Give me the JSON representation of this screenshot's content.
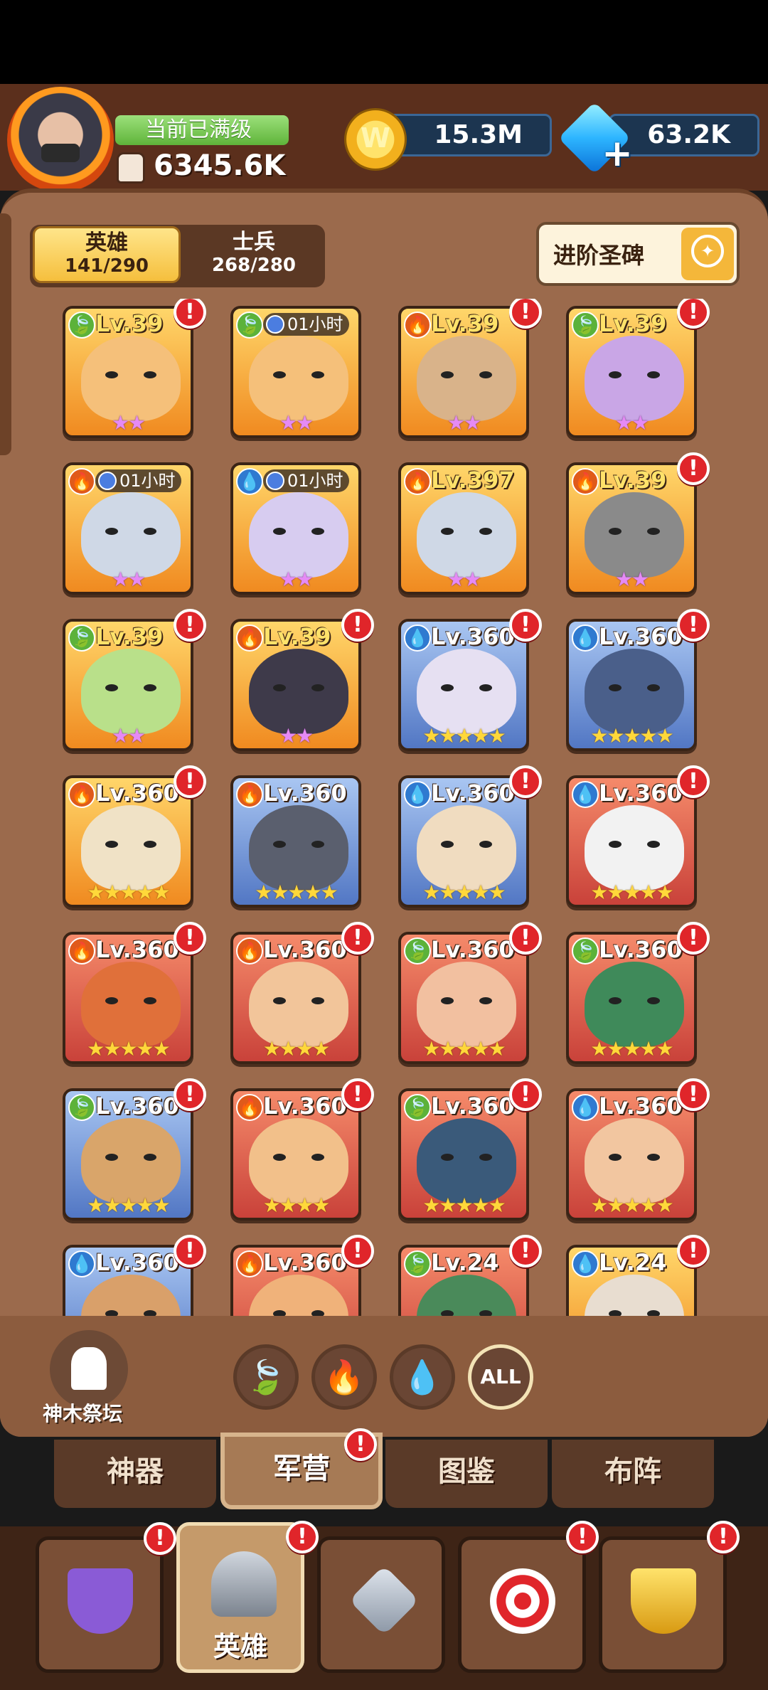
{
  "header": {
    "max_level_label": "当前已满级",
    "power": "6345.6K",
    "gold": "15.3M",
    "gems": "63.2K",
    "coin_symbol": "W",
    "gem_plus": "+"
  },
  "tabs": {
    "hero_label": "英雄",
    "hero_count": "141/290",
    "soldier_label": "士兵",
    "soldier_count": "268/280",
    "advance_label": "进阶圣碑"
  },
  "heroes": [
    {
      "element": "leaf",
      "level": "Lv.39",
      "stars": "★★",
      "star_color": "pink",
      "badge": true,
      "frame": "gold",
      "face": "#f5c07a"
    },
    {
      "element": "leaf",
      "timer": "01小时",
      "stars": "★★",
      "star_color": "pink",
      "badge": false,
      "frame": "gold",
      "face": "#f5c07a"
    },
    {
      "element": "fire",
      "level": "Lv.39",
      "stars": "★★",
      "star_color": "pink",
      "badge": true,
      "frame": "gold",
      "face": "#d9b38a"
    },
    {
      "element": "leaf",
      "level": "Lv.39",
      "stars": "★★",
      "star_color": "pink",
      "badge": true,
      "frame": "gold",
      "face": "#c9a6e6"
    },
    {
      "element": "fire",
      "timer": "01小时",
      "stars": "★★",
      "star_color": "pink",
      "badge": false,
      "frame": "gold",
      "face": "#cfd8e6"
    },
    {
      "element": "water",
      "timer": "01小时",
      "stars": "★★",
      "star_color": "pink",
      "badge": false,
      "frame": "gold",
      "face": "#d7ccf0"
    },
    {
      "element": "fire",
      "level": "Lv.397",
      "stars": "★★",
      "star_color": "pink",
      "badge": false,
      "frame": "gold",
      "face": "#cfd8e6"
    },
    {
      "element": "fire",
      "level": "Lv.39",
      "stars": "★★",
      "star_color": "pink",
      "badge": true,
      "frame": "gold",
      "face": "#8a8a8a"
    },
    {
      "element": "leaf",
      "level": "Lv.39",
      "stars": "★★",
      "star_color": "pink",
      "badge": true,
      "frame": "gold",
      "face": "#b9e08a"
    },
    {
      "element": "fire",
      "level": "Lv.39",
      "stars": "★★",
      "star_color": "pink",
      "badge": true,
      "frame": "gold",
      "face": "#3e3a4a"
    },
    {
      "element": "water",
      "level": "Lv.360",
      "stars": "★★★★★",
      "star_color": "gold",
      "badge": true,
      "frame": "blue",
      "face": "#e6e0f2"
    },
    {
      "element": "water",
      "level": "Lv.360",
      "stars": "★★★★★",
      "star_color": "gold",
      "badge": true,
      "frame": "blue",
      "face": "#4a5f8a"
    },
    {
      "element": "fire",
      "level": "Lv.360",
      "stars": "★★★★★",
      "star_color": "gold",
      "badge": true,
      "frame": "gold",
      "face": "#f0e2c6"
    },
    {
      "element": "fire",
      "level": "Lv.360",
      "stars": "★★★★★",
      "star_color": "gold",
      "badge": false,
      "frame": "blue",
      "face": "#5a5f6e"
    },
    {
      "element": "water",
      "level": "Lv.360",
      "stars": "★★★★★",
      "star_color": "gold",
      "badge": true,
      "frame": "blue",
      "face": "#f0dcc0"
    },
    {
      "element": "water",
      "level": "Lv.360",
      "stars": "★★★★★",
      "star_color": "gold",
      "badge": true,
      "frame": "red",
      "face": "#f2f2f2"
    },
    {
      "element": "fire",
      "level": "Lv.360",
      "stars": "★★★★★",
      "star_color": "gold",
      "badge": true,
      "frame": "red",
      "face": "#e0703a"
    },
    {
      "element": "fire",
      "level": "Lv.360",
      "stars": "★★★★",
      "star_color": "gold",
      "badge": true,
      "frame": "red",
      "face": "#f2c59a"
    },
    {
      "element": "leaf",
      "level": "Lv.360",
      "stars": "★★★★★",
      "star_color": "gold",
      "badge": true,
      "frame": "red",
      "face": "#f2c0a0"
    },
    {
      "element": "leaf",
      "level": "Lv.360",
      "stars": "★★★★★",
      "star_color": "gold",
      "badge": true,
      "frame": "red",
      "face": "#3f8a5a"
    },
    {
      "element": "leaf",
      "level": "Lv.360",
      "stars": "★★★★★",
      "star_color": "gold",
      "badge": true,
      "frame": "blue",
      "face": "#d9a56a"
    },
    {
      "element": "fire",
      "level": "Lv.360",
      "stars": "★★★★",
      "star_color": "gold",
      "badge": true,
      "frame": "red",
      "face": "#f2c08a"
    },
    {
      "element": "leaf",
      "level": "Lv.360",
      "stars": "★★★★★",
      "star_color": "gold",
      "badge": true,
      "frame": "red",
      "face": "#3a5a7a"
    },
    {
      "element": "water",
      "level": "Lv.360",
      "stars": "★★★★★",
      "star_color": "gold",
      "badge": true,
      "frame": "red",
      "face": "#f2c6a0"
    },
    {
      "element": "water",
      "level": "Lv.360",
      "stars": "",
      "star_color": "gold",
      "badge": true,
      "frame": "blue",
      "face": "#d9a06a"
    },
    {
      "element": "fire",
      "level": "Lv.360",
      "stars": "",
      "star_color": "gold",
      "badge": true,
      "frame": "red",
      "face": "#f0b27a"
    },
    {
      "element": "leaf",
      "level": "Lv.24",
      "stars": "",
      "star_color": "gold",
      "badge": true,
      "frame": "red",
      "face": "#4a8a5a"
    },
    {
      "element": "water",
      "level": "Lv.24",
      "stars": "",
      "star_color": "gold",
      "badge": true,
      "frame": "gold",
      "face": "#e8ddd0"
    }
  ],
  "filters": {
    "altar_label": "神木祭坛",
    "leaf_icon": "🍃",
    "fire_icon": "🔥",
    "water_icon": "💧",
    "all_label": "ALL"
  },
  "subtabs": [
    "神器",
    "军营",
    "图鉴",
    "布阵"
  ],
  "dock": {
    "hero_label": "英雄",
    "badge": "!"
  },
  "element_icons": {
    "leaf": "🍃",
    "fire": "🔥",
    "water": "💧"
  }
}
